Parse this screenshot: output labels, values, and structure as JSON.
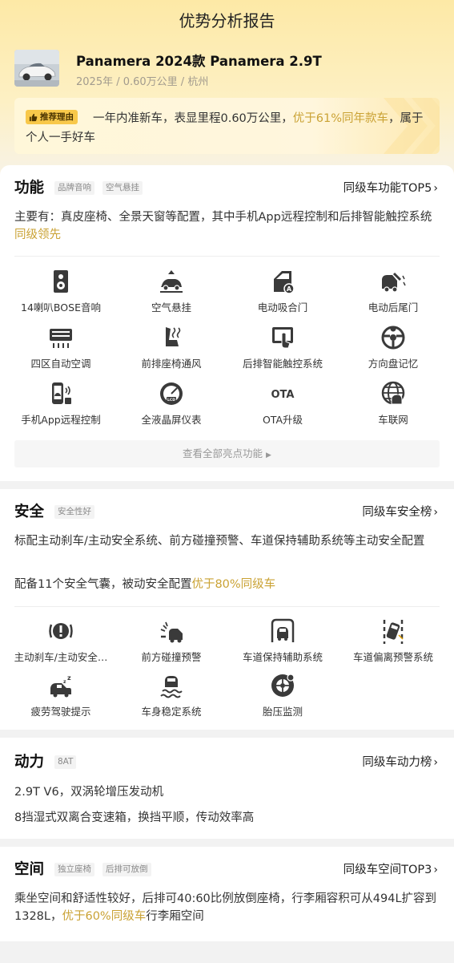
{
  "header": {
    "title": "优势分析报告",
    "car_name": "Panamera 2024款 Panamera 2.9T",
    "car_meta": "2025年 / 0.60万公里 / 杭州",
    "reason_tag": "推荐理由",
    "reason_part1": "一年内准新车，表显里程0.60万公里，",
    "reason_highlight": "优于61%同年款车",
    "reason_part2": "，属于个人一手好车"
  },
  "features": {
    "title": "功能",
    "tags": [
      "品牌音响",
      "空气悬挂"
    ],
    "rank": "同级车功能TOP5",
    "desc_main": "主要有：真皮座椅、全景天窗等配置，其中手机App远程控制和后排智能触控系统",
    "desc_highlight": "同级领先",
    "items": [
      {
        "label": "14喇叭BOSE音响",
        "icon": "speaker-icon"
      },
      {
        "label": "空气悬挂",
        "icon": "air-suspension-icon"
      },
      {
        "label": "电动吸合门",
        "icon": "soft-close-door-icon"
      },
      {
        "label": "电动后尾门",
        "icon": "power-tailgate-icon"
      },
      {
        "label": "四区自动空调",
        "icon": "climate-control-icon"
      },
      {
        "label": "前排座椅通风",
        "icon": "seat-ventilation-icon"
      },
      {
        "label": "后排智能触控系统",
        "icon": "rear-touch-control-icon"
      },
      {
        "label": "方向盘记忆",
        "icon": "steering-memory-icon"
      },
      {
        "label": "手机App远程控制",
        "icon": "phone-remote-icon"
      },
      {
        "label": "全液晶屏仪表",
        "icon": "lcd-cluster-icon"
      },
      {
        "label": "OTA升级",
        "icon": "ota-icon"
      },
      {
        "label": "车联网",
        "icon": "globe-icon"
      }
    ],
    "more_label": "查看全部亮点功能"
  },
  "safety": {
    "title": "安全",
    "tags": [
      "安全性好"
    ],
    "rank": "同级车安全榜",
    "desc1": "标配主动刹车/主动安全系统、前方碰撞预警、车道保持辅助系统等主动安全配置",
    "desc2_main": "配备11个安全气囊，被动安全配置",
    "desc2_highlight": "优于80%同级车",
    "items": [
      {
        "label": "主动刹车/主动安全…",
        "icon": "active-brake-icon"
      },
      {
        "label": "前方碰撞预警",
        "icon": "collision-warning-icon"
      },
      {
        "label": "车道保持辅助系统",
        "icon": "lane-keep-icon"
      },
      {
        "label": "车道偏离预警系统",
        "icon": "lane-departure-icon"
      },
      {
        "label": "疲劳驾驶提示",
        "icon": "fatigue-alert-icon"
      },
      {
        "label": "车身稳定系统",
        "icon": "stability-control-icon"
      },
      {
        "label": "胎压监测",
        "icon": "tire-pressure-icon"
      }
    ]
  },
  "power": {
    "title": "动力",
    "tags": [
      "8AT"
    ],
    "rank": "同级车动力榜",
    "line1": "2.9T V6，双涡轮增压发动机",
    "line2": "8挡湿式双离合变速箱，换挡平顺，传动效率高"
  },
  "space": {
    "title": "空间",
    "tags": [
      "独立座椅",
      "后排可放倒"
    ],
    "rank": "同级车空间TOP3",
    "desc_main": "乘坐空间和舒适性较好，后排可40:60比例放倒座椅，行李厢容积可从494L扩容到1328L，",
    "desc_highlight": "优于60%同级车",
    "desc_tail": "行李厢空间"
  },
  "colors": {
    "highlight": "#caa234",
    "tag_yellow": "#f8c84a",
    "icon": "#3a3a3a"
  }
}
